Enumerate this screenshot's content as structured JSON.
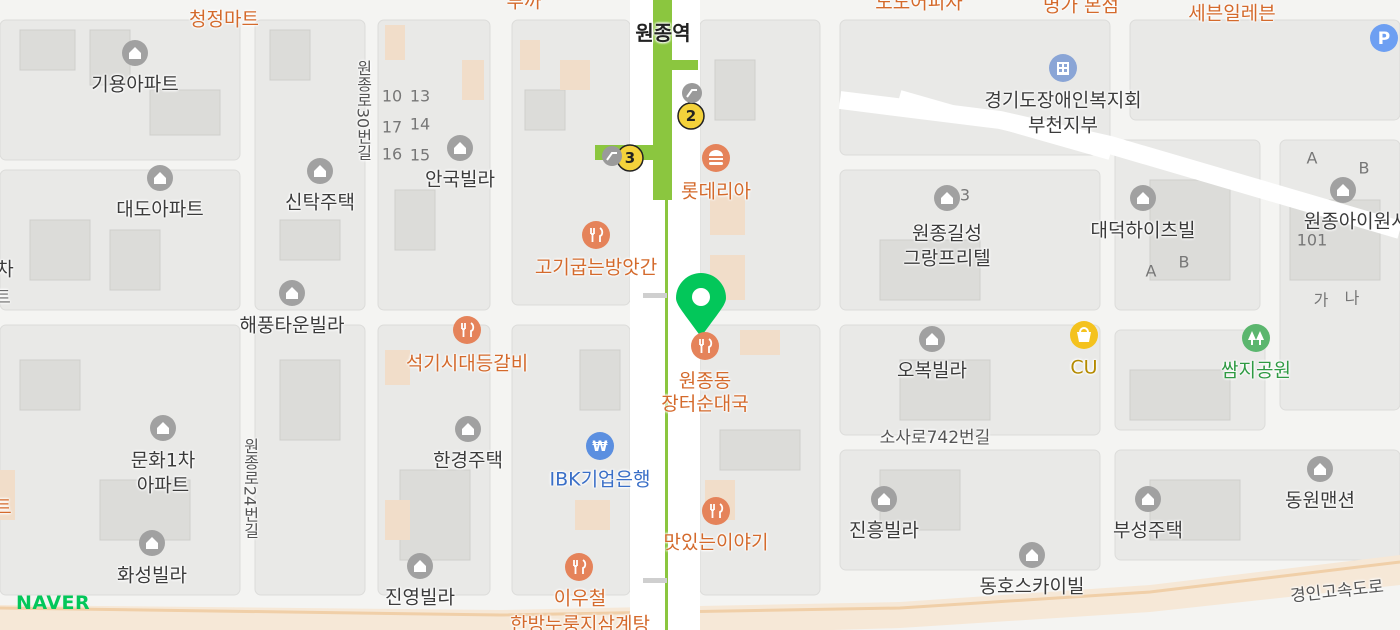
{
  "map": {
    "provider_logo": "NAVER",
    "station": {
      "name": "원종역",
      "exit_2": "2",
      "exit_3": "3"
    },
    "selected_place": {
      "name_line1": "원종동",
      "name_line2": "장터순대국",
      "icon": "restaurant-icon"
    },
    "roads": {
      "expressway": "경인고속도로",
      "soksa_742": "소사로742번길",
      "wonjong_30": "원종로30번길",
      "wonjong_24": "원종로24번길"
    },
    "residential": [
      {
        "id": "giyong",
        "name": "기용아파트"
      },
      {
        "id": "daedo",
        "name": "대도아파트"
      },
      {
        "id": "sintak",
        "name": "신탁주택"
      },
      {
        "id": "angukvilla",
        "name": "안국빌라"
      },
      {
        "id": "haepung",
        "name": "해풍타운빌라"
      },
      {
        "id": "munhwa",
        "name": "문화1차\n아파트"
      },
      {
        "id": "hwaseong",
        "name": "화성빌라"
      },
      {
        "id": "hangyeong",
        "name": "한경주택"
      },
      {
        "id": "jinyeong",
        "name": "진영빌라"
      },
      {
        "id": "wonjonggil",
        "name": "원종길성\n그랑프리텔"
      },
      {
        "id": "daedeok",
        "name": "대덕하이츠빌"
      },
      {
        "id": "obok",
        "name": "오복빌라"
      },
      {
        "id": "jinheung",
        "name": "진흥빌라"
      },
      {
        "id": "buseong",
        "name": "부성주택"
      },
      {
        "id": "dongho",
        "name": "동호스카이빌"
      },
      {
        "id": "dongwon",
        "name": "동원맨션"
      },
      {
        "id": "wonjongai",
        "name": "원종아이원시티"
      },
      {
        "id": "gyeonggi",
        "name": "경기도장애인복지회\n부천지부"
      }
    ],
    "restaurants": [
      {
        "id": "lotteria",
        "name": "롯데리아",
        "icon": "burger-icon"
      },
      {
        "id": "gogi",
        "name": "고기굽는방앗간",
        "icon": "restaurant-icon"
      },
      {
        "id": "seokgisi",
        "name": "석기시대등갈비",
        "icon": "restaurant-icon"
      },
      {
        "id": "masinneun",
        "name": "맛있는이야기",
        "icon": "restaurant-icon"
      },
      {
        "id": "iucheol",
        "name": "이우철\n한방누룽지삼계탕",
        "icon": "restaurant-icon"
      }
    ],
    "others": {
      "ibk": "IBK기업은행",
      "cu": "CU",
      "park": "쌈지공원",
      "top_mart": "청정마트",
      "top_seven": "세븐일레븐",
      "top_myeongga": "명가 본점",
      "top_dodo": "도도어피자",
      "top_left": "투까",
      "cut_left1": "차",
      "cut_left2": "트",
      "cut_left3": "트",
      "parking": "P"
    },
    "numbers": {
      "n10": "10",
      "n13": "13",
      "n17": "17",
      "n14": "14",
      "n16": "16",
      "n15": "15",
      "b3": "3",
      "A1": "A",
      "B1": "B",
      "A2": "A",
      "B2": "B",
      "n101": "101",
      "ga": "가",
      "na": "나"
    },
    "colors": {
      "subway_line": "#8bc63f",
      "marker": "#03c75a",
      "poi_orange": "#e5835a",
      "road": "#ffffff",
      "block": "#e9e9e7"
    }
  }
}
